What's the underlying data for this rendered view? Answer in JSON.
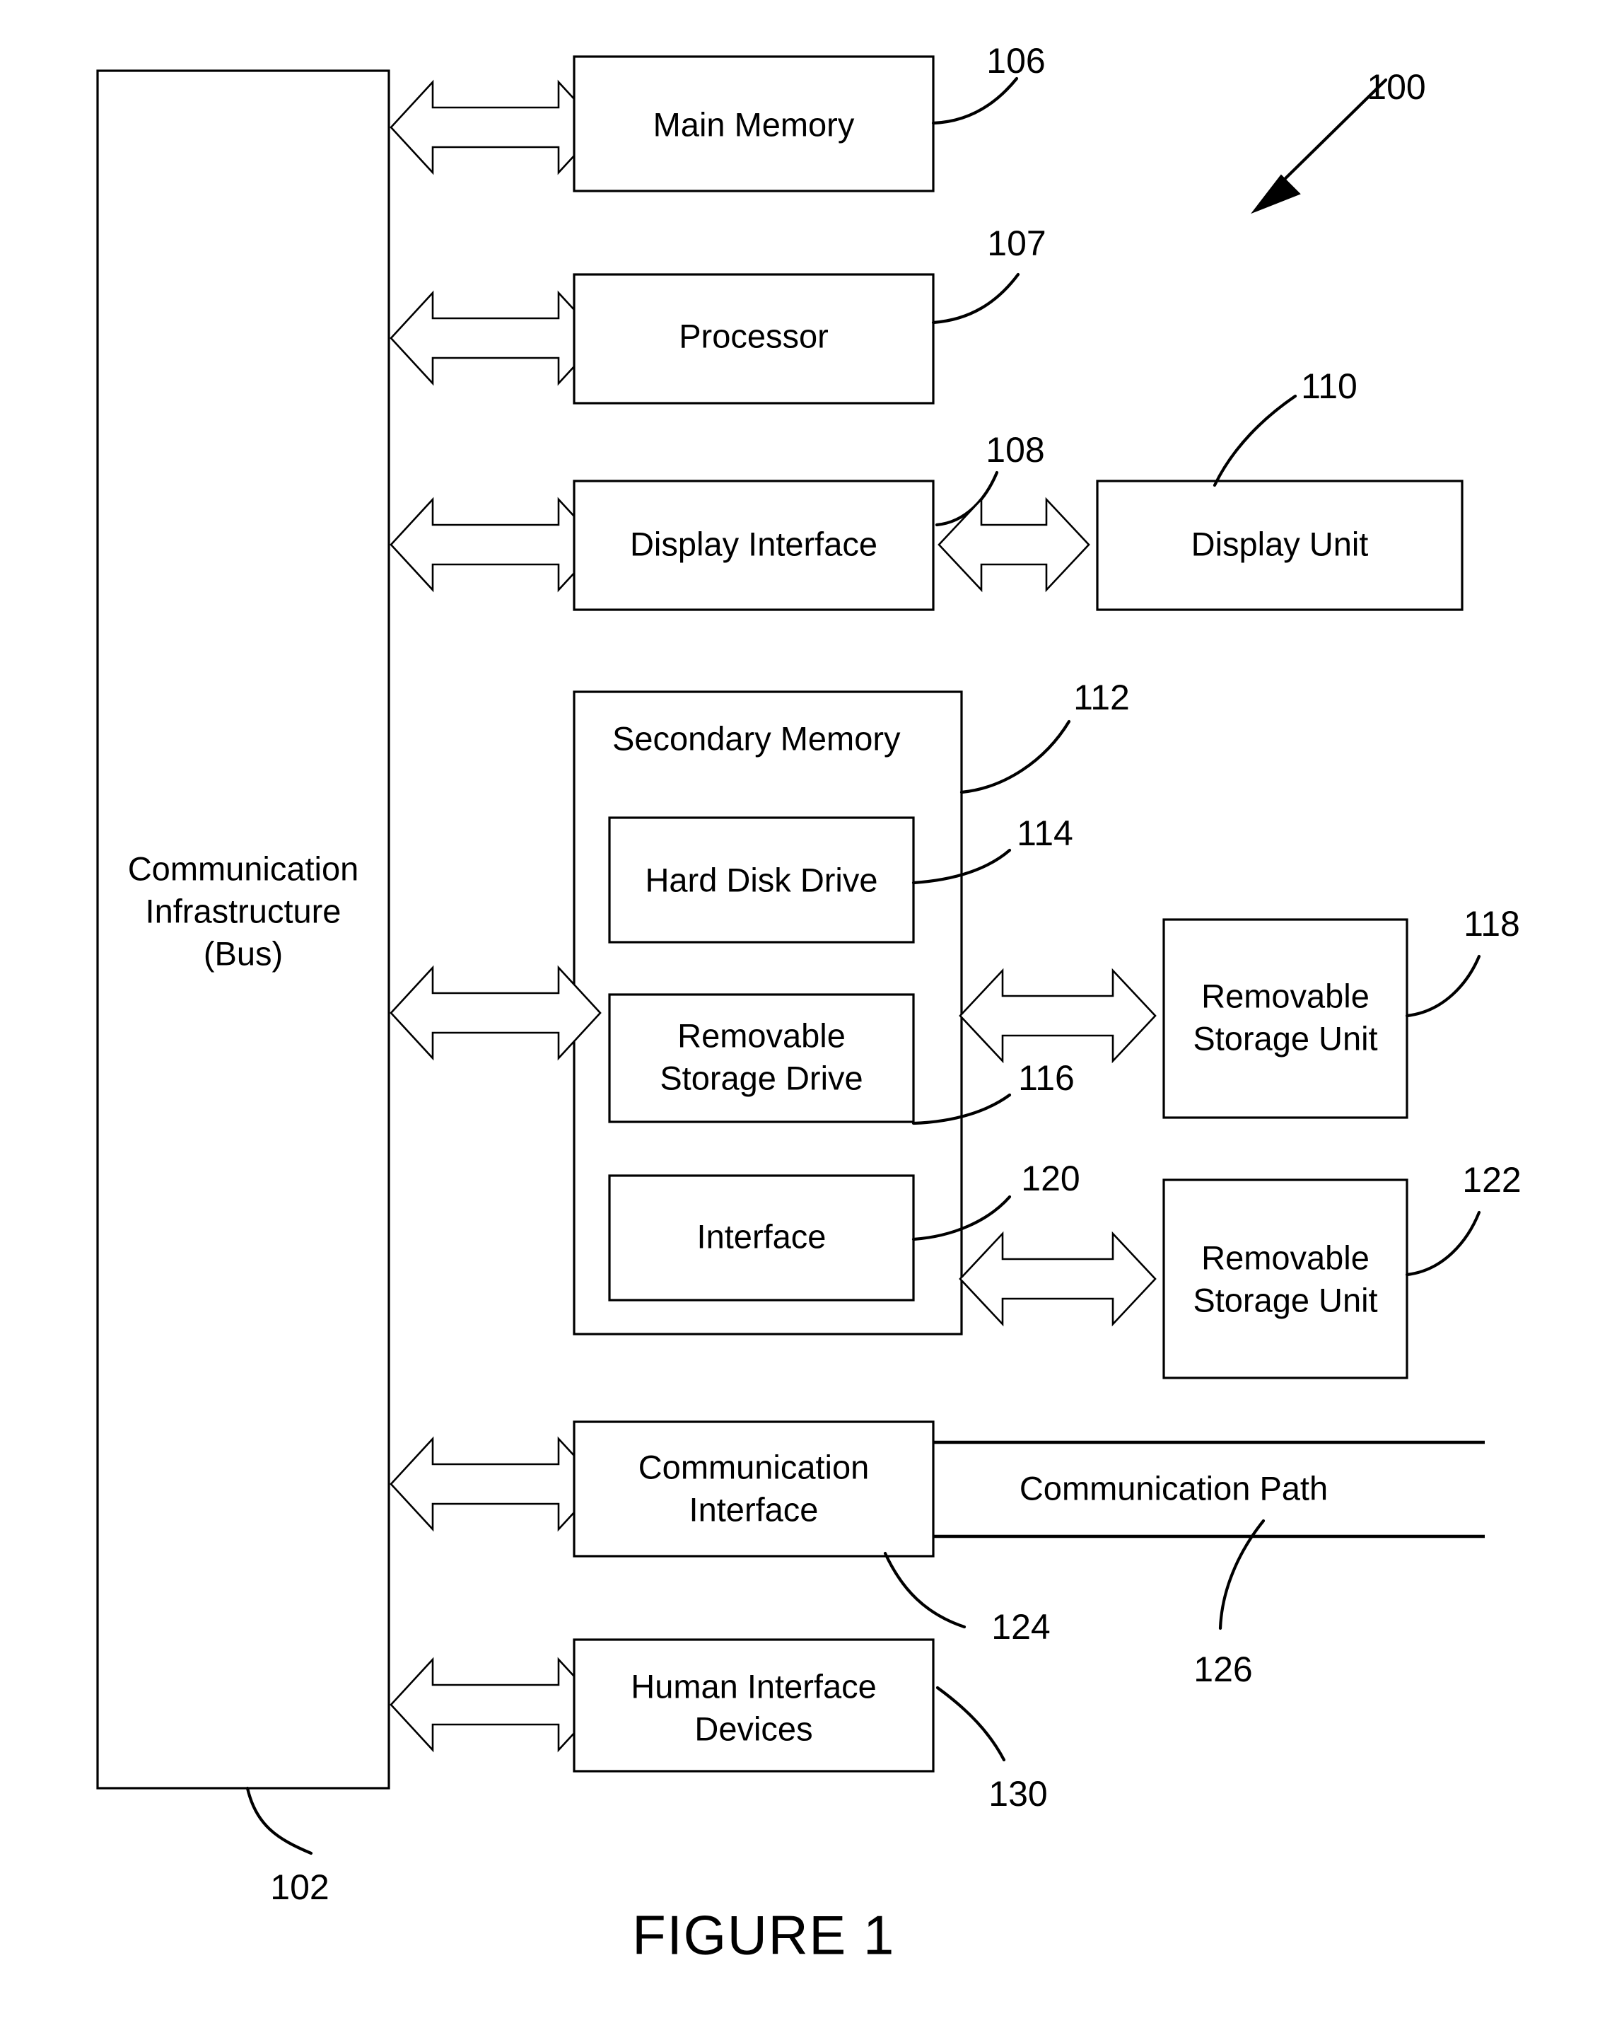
{
  "figure": {
    "caption": "FIGURE 1",
    "system_ref": "100"
  },
  "bus": {
    "label_line1": "Communication",
    "label_line2": "Infrastructure",
    "label_line3": "(Bus)",
    "ref": "102"
  },
  "blocks": {
    "main_memory": {
      "label": "Main Memory",
      "ref": "106"
    },
    "processor": {
      "label": "Processor",
      "ref": "107"
    },
    "display_interface": {
      "label": "Display Interface",
      "ref": "108"
    },
    "display_unit": {
      "label": "Display Unit",
      "ref": "110"
    },
    "secondary_memory": {
      "label": "Secondary Memory",
      "ref": "112"
    },
    "hard_disk_drive": {
      "label": "Hard Disk Drive",
      "ref": "114"
    },
    "removable_storage_drive": {
      "label_line1": "Removable",
      "label_line2": "Storage Drive",
      "ref": "116"
    },
    "removable_storage_unit_1": {
      "label_line1": "Removable",
      "label_line2": "Storage Unit",
      "ref": "118"
    },
    "interface": {
      "label": "Interface",
      "ref": "120"
    },
    "removable_storage_unit_2": {
      "label_line1": "Removable",
      "label_line2": "Storage Unit",
      "ref": "122"
    },
    "communication_interface": {
      "label_line1": "Communication",
      "label_line2": "Interface",
      "ref": "124"
    },
    "communication_path": {
      "label": "Communication Path",
      "ref": "126"
    },
    "human_interface_devices": {
      "label_line1": "Human Interface",
      "label_line2": "Devices",
      "ref": "130"
    }
  },
  "colors": {
    "stroke": "#000000",
    "fill": "#ffffff"
  }
}
